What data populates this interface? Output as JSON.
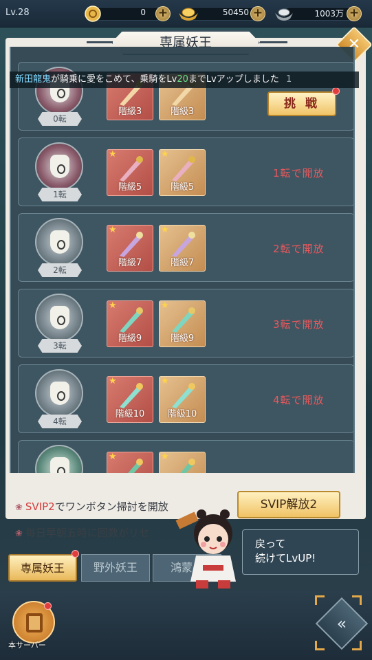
{
  "topbar": {
    "level": "Lv.28",
    "resources": [
      {
        "icon": "coin-icon",
        "value": "0"
      },
      {
        "icon": "gold-ingot-icon",
        "value": "50450"
      },
      {
        "icon": "silver-ingot-icon",
        "value": "1003万"
      }
    ],
    "plus_label": "+"
  },
  "panel": {
    "title": "専属妖王",
    "close_label": "✕"
  },
  "marquee": {
    "name": "新田龍鬼",
    "text_before": "が騎乗に愛をこめて、乗騎をLv",
    "number": "20",
    "text_after": "までLvアップしました",
    "tail": "1"
  },
  "rows": [
    {
      "tenshi": "0転",
      "items": [
        {
          "label": "階級3",
          "star": false
        },
        {
          "label": "階級3",
          "star": false
        }
      ],
      "action": "挑 戦",
      "status": ""
    },
    {
      "tenshi": "1転",
      "items": [
        {
          "label": "階級5",
          "star": true
        },
        {
          "label": "階級5",
          "star": true
        }
      ],
      "status": "1転で開放"
    },
    {
      "tenshi": "2転",
      "items": [
        {
          "label": "階級7",
          "star": true
        },
        {
          "label": "階級7",
          "star": true
        }
      ],
      "status": "2転で開放"
    },
    {
      "tenshi": "3転",
      "items": [
        {
          "label": "階級9",
          "star": true
        },
        {
          "label": "階級9",
          "star": true
        }
      ],
      "status": "3転で開放"
    },
    {
      "tenshi": "4転",
      "items": [
        {
          "label": "階級10",
          "star": true
        },
        {
          "label": "階級10",
          "star": true
        }
      ],
      "status": "4転で開放"
    }
  ],
  "star_glyph": "★",
  "info": {
    "line1_hl": "SVIP2",
    "line1_rest": "でワンボタン掃討を開放",
    "line2": "毎日早朝五時に回数がリセ",
    "svip_button": "SVIP解放2"
  },
  "tabs": [
    {
      "label": "専属妖王",
      "active": true
    },
    {
      "label": "野外妖王",
      "active": false
    },
    {
      "label": "鴻蒙の",
      "active": false
    }
  ],
  "bubble": {
    "line1": "戻って",
    "line2": "続けてLvUP!"
  },
  "bottom": {
    "server_label": "本サーバー",
    "diamond_icon": "return-icon"
  },
  "colors": {
    "accent_gold": "#f0c264",
    "status_red": "#e8585c",
    "notify_dot": "#e23d3d"
  }
}
